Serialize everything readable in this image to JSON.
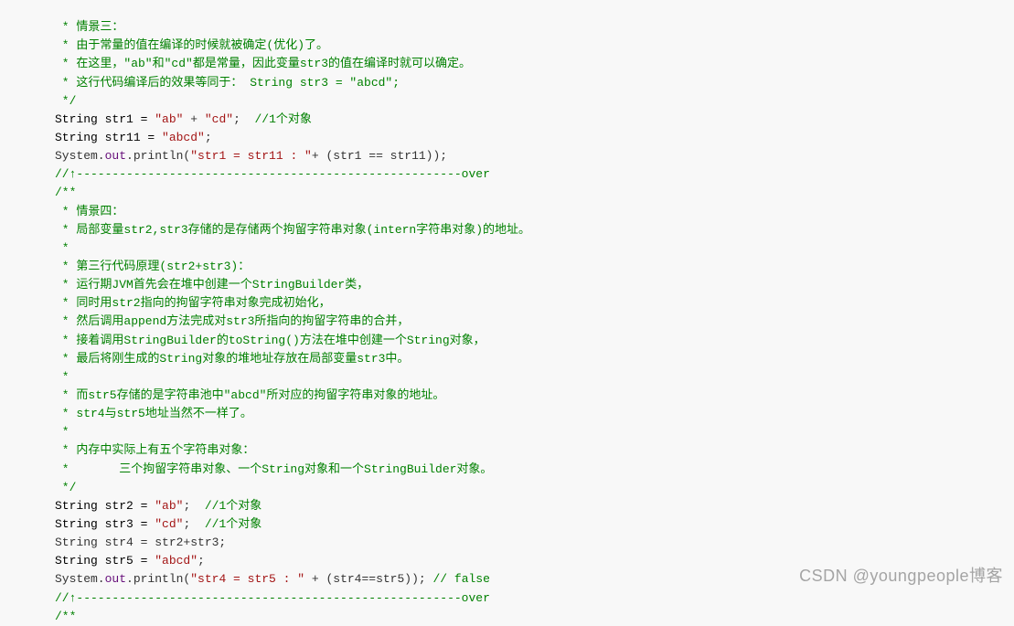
{
  "code": {
    "c1": " * 情景三：",
    "c2": " * 由于常量的值在编译的时候就被确定(优化)了。",
    "c3": " * 在这里，\"ab\"和\"cd\"都是常量，因此变量str3的值在编译时就可以确定。",
    "c4": " * 这行代码编译后的效果等同于： String str3 = \"abcd\";",
    "c5": " */",
    "l1a": "String str1 = ",
    "l1s1": "\"ab\"",
    "l1b": " + ",
    "l1s2": "\"cd\"",
    "l1c": ";  ",
    "l1cm": "//1个对象",
    "l2a": "String str11 = ",
    "l2s": "\"abcd\"",
    "l2b": ";",
    "l3a": "System.",
    "l3f": "out",
    "l3b": ".println(",
    "l3s": "\"str1 = str11 : \"",
    "l3c": "+ (str1 == str11));",
    "c6": "//↑------------------------------------------------------over",
    "c7": "/**",
    "c8": " * 情景四：",
    "c9": " * 局部变量str2,str3存储的是存储两个拘留字符串对象(intern字符串对象)的地址。",
    "c10": " *",
    "c11": " * 第三行代码原理(str2+str3)：",
    "c12": " * 运行期JVM首先会在堆中创建一个StringBuilder类，",
    "c13": " * 同时用str2指向的拘留字符串对象完成初始化，",
    "c14": " * 然后调用append方法完成对str3所指向的拘留字符串的合并，",
    "c15": " * 接着调用StringBuilder的toString()方法在堆中创建一个String对象，",
    "c16": " * 最后将刚生成的String对象的堆地址存放在局部变量str3中。",
    "c17": " *",
    "c18": " * 而str5存储的是字符串池中\"abcd\"所对应的拘留字符串对象的地址。",
    "c19": " * str4与str5地址当然不一样了。",
    "c20": " *",
    "c21": " * 内存中实际上有五个字符串对象：",
    "c22": " *       三个拘留字符串对象、一个String对象和一个StringBuilder对象。",
    "c23": " */",
    "l4a": "String str2 = ",
    "l4s": "\"ab\"",
    "l4b": ";  ",
    "l4cm": "//1个对象",
    "l5a": "String str3 = ",
    "l5s": "\"cd\"",
    "l5b": ";  ",
    "l5cm": "//1个对象",
    "l6": "String str4 = str2+str3;",
    "l7a": "String str5 = ",
    "l7s": "\"abcd\"",
    "l7b": ";",
    "l8a": "System.",
    "l8f": "out",
    "l8b": ".println(",
    "l8s": "\"str4 = str5 : \"",
    "l8c": " + (str4==str5)); ",
    "l8cm": "// false",
    "c24": "//↑------------------------------------------------------over",
    "c25": "/**"
  },
  "watermark": "CSDN @youngpeople博客"
}
